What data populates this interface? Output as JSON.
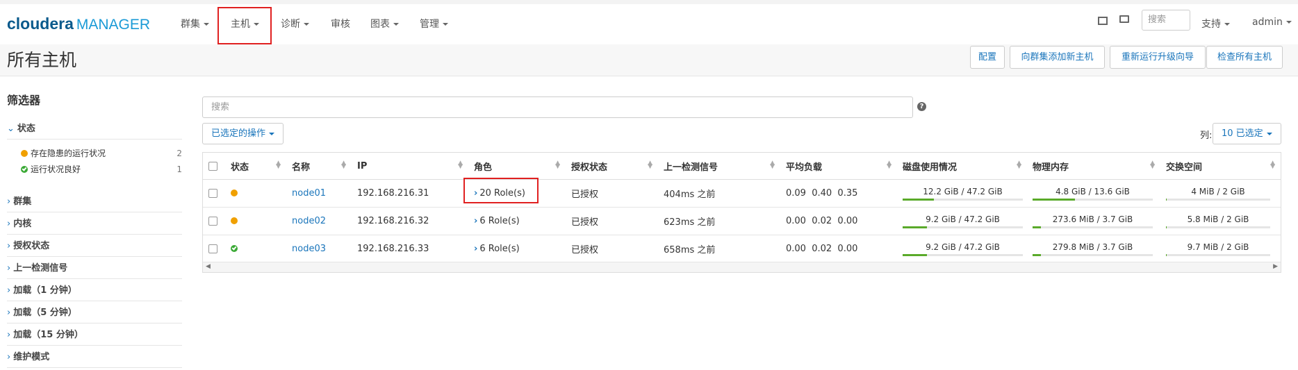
{
  "brand": {
    "name_bold": "cloudera",
    "name_suffix": "MANAGER"
  },
  "nav": {
    "items": [
      {
        "label": "群集",
        "dropdown": true
      },
      {
        "label": "主机",
        "dropdown": true,
        "highlighted": true
      },
      {
        "label": "诊断",
        "dropdown": true
      },
      {
        "label": "审核",
        "dropdown": false
      },
      {
        "label": "图表",
        "dropdown": true
      },
      {
        "label": "管理",
        "dropdown": true
      }
    ],
    "search_placeholder": "搜索",
    "support_label": "支持",
    "user_label": "admin"
  },
  "page": {
    "title": "所有主机",
    "buttons": [
      "配置",
      "向群集添加新主机",
      "重新运行升级向导",
      "检查所有主机"
    ]
  },
  "sidebar": {
    "title": "筛选器",
    "status_section": {
      "label": "状态",
      "items": [
        {
          "label": "存在隐患的运行状况",
          "count": "2",
          "status": "warn"
        },
        {
          "label": "运行状况良好",
          "count": "1",
          "status": "ok"
        }
      ]
    },
    "sections": [
      "群集",
      "内核",
      "授权状态",
      "上一检测信号",
      "加载（1 分钟）",
      "加载（5 分钟）",
      "加载（15 分钟）",
      "维护模式"
    ]
  },
  "main": {
    "search_placeholder": "搜索",
    "actions_label": "已选定的操作",
    "columns_label": "列:",
    "columns_selected": "10 已选定"
  },
  "table": {
    "headers": [
      "状态",
      "名称",
      "IP",
      "角色",
      "授权状态",
      "上一检测信号",
      "平均负载",
      "磁盘使用情况",
      "物理内存",
      "交换空间"
    ],
    "rows": [
      {
        "status": "warn",
        "name": "node01",
        "ip": "192.168.216.31",
        "roles": "20 Role(s)",
        "auth": "已授权",
        "heartbeat": "404ms 之前",
        "load": "0.09  0.40  0.35",
        "disk": "12.2 GiB / 47.2 GiB",
        "disk_pct": 0.26,
        "mem": "4.8 GiB / 13.6 GiB",
        "mem_pct": 0.35,
        "swap": "4 MiB / 2 GiB",
        "swap_pct": 0.002
      },
      {
        "status": "warn",
        "name": "node02",
        "ip": "192.168.216.32",
        "roles": "6 Role(s)",
        "auth": "已授权",
        "heartbeat": "623ms 之前",
        "load": "0.00  0.02  0.00",
        "disk": "9.2 GiB / 47.2 GiB",
        "disk_pct": 0.2,
        "mem": "273.6 MiB / 3.7 GiB",
        "mem_pct": 0.07,
        "swap": "5.8 MiB / 2 GiB",
        "swap_pct": 0.003
      },
      {
        "status": "ok",
        "name": "node03",
        "ip": "192.168.216.33",
        "roles": "6 Role(s)",
        "auth": "已授权",
        "heartbeat": "658ms 之前",
        "load": "0.00  0.02  0.00",
        "disk": "9.2 GiB / 47.2 GiB",
        "disk_pct": 0.2,
        "mem": "279.8 MiB / 3.7 GiB",
        "mem_pct": 0.07,
        "swap": "9.7 MiB / 2 GiB",
        "swap_pct": 0.005
      }
    ]
  },
  "colors": {
    "accent": "#1a75bb",
    "warn": "#f0a000",
    "ok": "#3aa935",
    "highlight_box": "#e02020",
    "bar_fill": "#5aaa2a"
  }
}
